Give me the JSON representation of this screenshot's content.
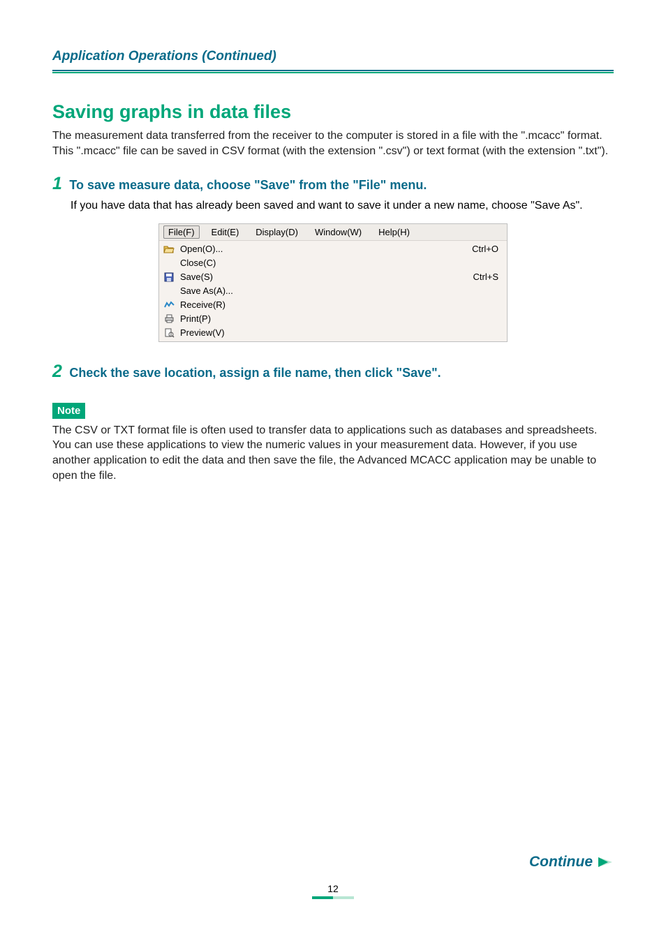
{
  "header": {
    "title": "Application Operations (Continued)"
  },
  "section": {
    "title": "Saving graphs in data files",
    "intro": "The measurement data transferred from the receiver to the computer is stored in a file with the \".mcacc\" format. This \".mcacc\" file can be saved in CSV format (with the extension \".csv\") or text format (with the extension \".txt\")."
  },
  "steps": [
    {
      "num": "1",
      "heading": "To save measure data, choose \"Save\" from the \"File\" menu.",
      "body": "If you have data that has already been saved and want to save it under a new name, choose \"Save As\"."
    },
    {
      "num": "2",
      "heading": "Check the save location, assign a file name, then click \"Save\".",
      "body": ""
    }
  ],
  "menu": {
    "bar": [
      {
        "label": "File(F)",
        "active": true
      },
      {
        "label": "Edit(E)",
        "active": false
      },
      {
        "label": "Display(D)",
        "active": false
      },
      {
        "label": "Window(W)",
        "active": false
      },
      {
        "label": "Help(H)",
        "active": false
      }
    ],
    "items": [
      {
        "icon": "folder-open-icon",
        "label": "Open(O)...",
        "shortcut": "Ctrl+O"
      },
      {
        "icon": "",
        "label": "Close(C)",
        "shortcut": ""
      },
      {
        "icon": "save-icon",
        "label": "Save(S)",
        "shortcut": "Ctrl+S"
      },
      {
        "icon": "",
        "label": "Save As(A)...",
        "shortcut": ""
      },
      {
        "icon": "receive-icon",
        "label": "Receive(R)",
        "shortcut": ""
      },
      {
        "icon": "printer-icon",
        "label": "Print(P)",
        "shortcut": ""
      },
      {
        "icon": "page-magnifier-icon",
        "label": "Preview(V)",
        "shortcut": ""
      }
    ]
  },
  "note": {
    "badge": "Note",
    "text": "The CSV or TXT format file is often used to transfer data to applications such as databases and spreadsheets. You can use these applications to view the numeric values in your measurement data. However, if you use another application to edit the data and then save the file, the Advanced MCACC application may be unable to open the file."
  },
  "footer": {
    "continue": "Continue",
    "pagenum": "12"
  }
}
